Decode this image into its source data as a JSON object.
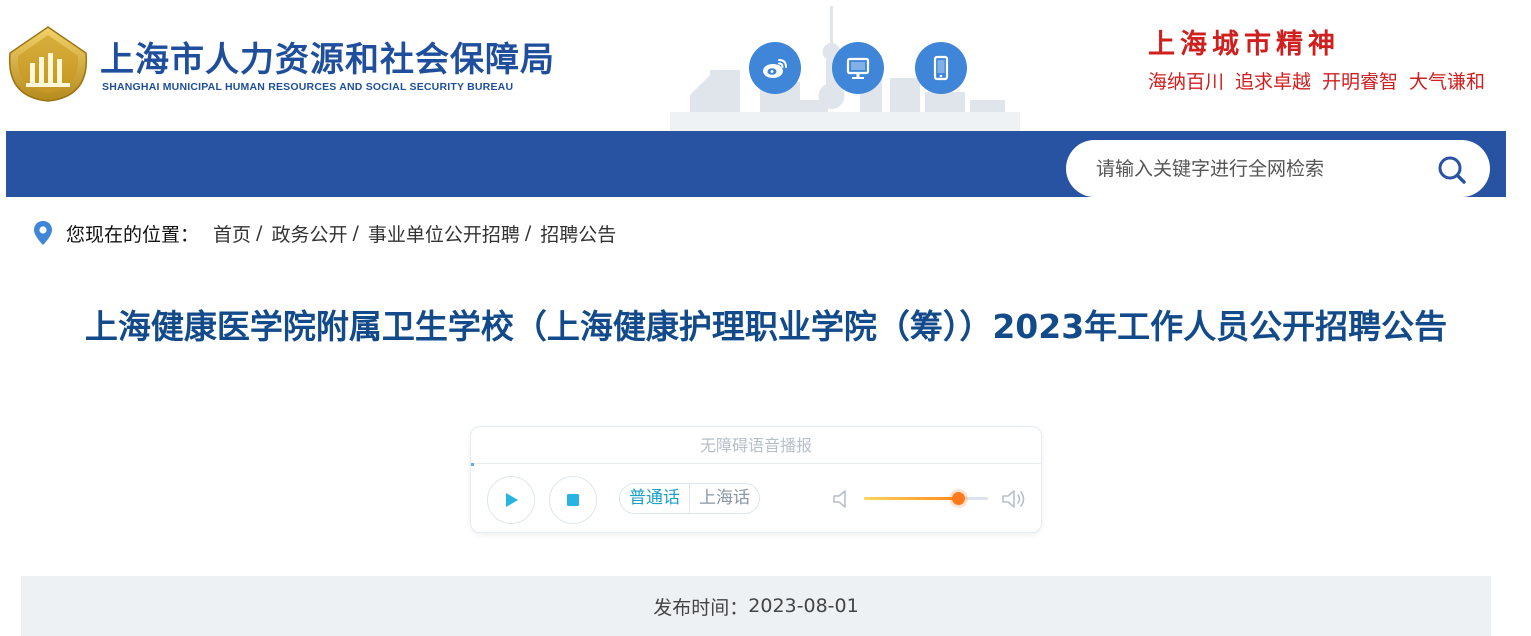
{
  "header": {
    "site_title": "上海市人力资源和社会保障局",
    "site_subtitle": "SHANGHAI MUNICIPAL HUMAN RESOURCES AND SOCIAL SECURITY BUREAU",
    "social_icons": [
      "weibo-icon",
      "desktop-icon",
      "mobile-icon"
    ],
    "spirit_title": "上海城市精神",
    "spirit_items": [
      "海纳百川",
      "追求卓越",
      "开明睿智",
      "大气谦和"
    ]
  },
  "search": {
    "placeholder": "请输入关键字进行全网检索"
  },
  "breadcrumb": {
    "label": "您现在的位置：",
    "items": [
      "首页",
      "政务公开",
      "事业单位公开招聘",
      "招聘公告"
    ],
    "separator": "/"
  },
  "article": {
    "title": "上海健康医学院附属卫生学校（上海健康护理职业学院（筹））2023年工作人员公开招聘公告",
    "publish_label": "发布时间：",
    "publish_date": "2023-08-01"
  },
  "player": {
    "title": "无障碍语音播报",
    "languages": [
      "普通话",
      "上海话"
    ],
    "active_language": "普通话",
    "volume": 0.76
  },
  "colors": {
    "brand_blue": "#2753a2",
    "title_blue": "#134a8a",
    "spirit_red": "#d01f1f",
    "social_blue": "#3f86d8"
  }
}
